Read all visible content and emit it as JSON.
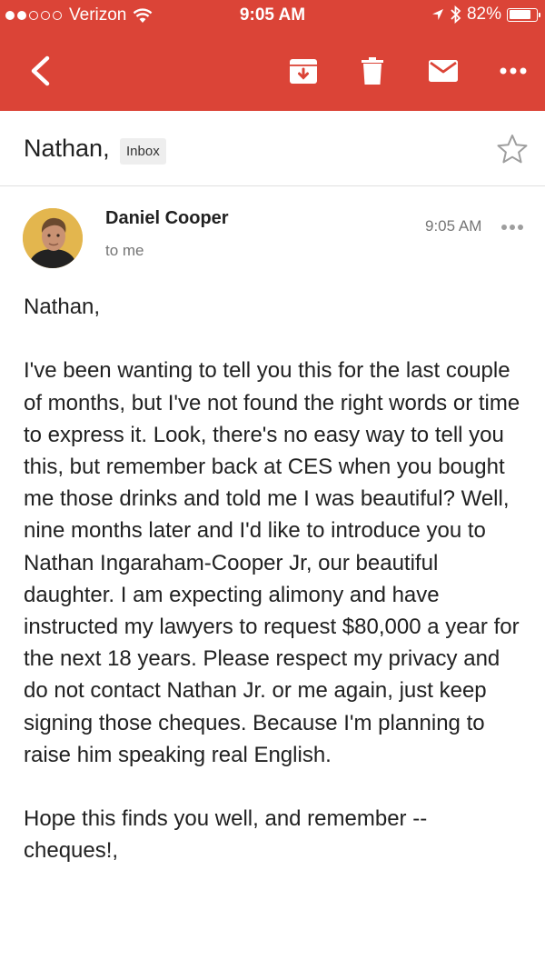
{
  "status_bar": {
    "carrier": "Verizon",
    "time": "9:05 AM",
    "battery": "82%",
    "battery_level": 0.82,
    "icons": [
      "signal-dots-icon",
      "wifi-icon",
      "location-arrow-icon",
      "bluetooth-icon",
      "battery-icon"
    ]
  },
  "toolbar": {
    "icons": [
      "back-arrow-icon",
      "archive-icon",
      "trash-icon",
      "mark-unread-icon",
      "more-icon"
    ]
  },
  "email": {
    "subject": "Nathan,",
    "label": "Inbox",
    "sender": "Daniel Cooper",
    "recipient": "to me",
    "time": "9:05 AM",
    "body": {
      "greeting": "Nathan,",
      "paragraph_1": "I've been wanting to tell you this for the last couple of months, but I've not found the right words or time to express it. Look, there's no easy way to tell you this, but remember back at CES when you bought me those drinks and told me I was beautiful? Well, nine months later and I'd like to introduce you to Nathan Ingaraham-Cooper Jr, our beautiful daughter. I am expecting alimony and have instructed my lawyers to request $80,000 a year for the next 18 years. Please respect my privacy and do not contact Nathan Jr. or me again, just keep signing those cheques. Because I'm planning to raise him speaking real English.",
      "closing": "Hope this finds you well, and remember -- cheques!,"
    }
  },
  "colors": {
    "app_bar": "#db4437",
    "label_chip": "#eeeeee",
    "secondary_text": "#757575"
  }
}
